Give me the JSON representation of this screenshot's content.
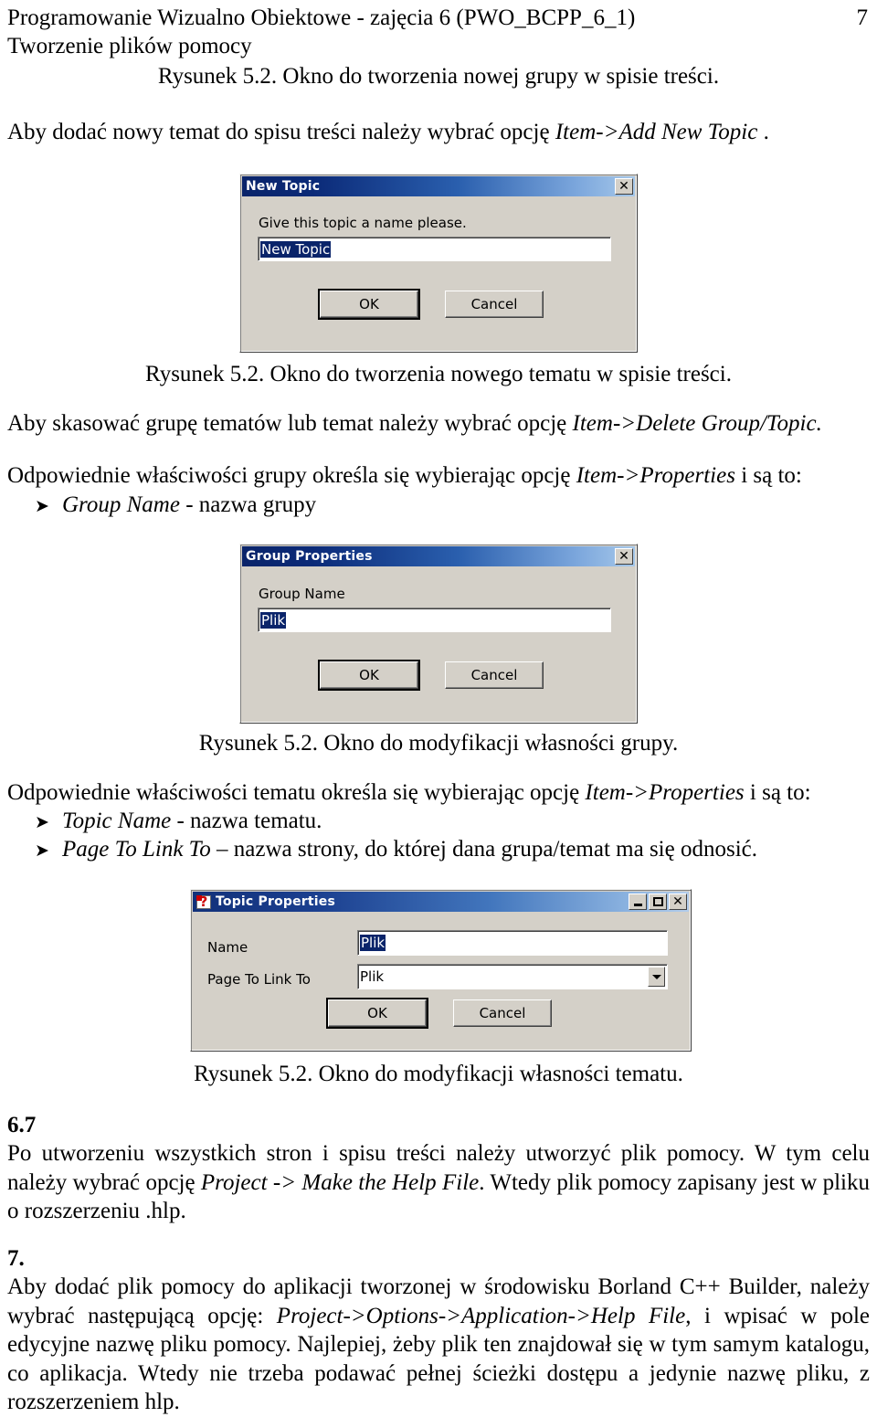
{
  "header": {
    "line1": "Programowanie Wizualno Obiektowe - zajęcia 6 (PWO_BCPP_6_1)",
    "line2": "Tworzenie plików pomocy",
    "page_number": "7"
  },
  "captions": {
    "fig1": "Rysunek 5.2. Okno do tworzenia nowej grupy w spisie treści.",
    "fig2": "Rysunek 5.2. Okno do tworzenia nowego tematu w spisie treści.",
    "fig3": "Rysunek 5.2. Okno do modyfikacji własności grupy.",
    "fig4": "Rysunek 5.2. Okno do modyfikacji własności tematu."
  },
  "body": {
    "para_add_topic_pre": "Aby dodać nowy temat do spisu treści należy wybrać opcję ",
    "para_add_topic_em": "Item->Add New Topic",
    "para_add_topic_post": " .",
    "para_delete_pre": "Aby skasować grupę tematów lub temat należy wybrać opcję ",
    "para_delete_em": "Item->Delete Group/Topic.",
    "para_group_props_pre": "Odpowiednie właściwości grupy określa się wybierając opcję ",
    "para_group_props_em": "Item->Properties",
    "para_group_props_post": " i są to:",
    "bullet_group_name_em": "Group Name",
    "bullet_group_name_rest": " - nazwa grupy",
    "para_topic_props_pre": "Odpowiednie właściwości tematu określa się wybierając opcję ",
    "para_topic_props_em": "Item->Properties",
    "para_topic_props_post": " i są to:",
    "bullet_topic_name_em": "Topic Name",
    "bullet_topic_name_rest": "   - nazwa tematu.",
    "bullet_page_link_em": "Page To Link To",
    "bullet_page_link_rest": " – nazwa strony, do której dana grupa/temat ma się odnosić.",
    "sec67_number": "6.7",
    "sec67_t1": "Po utworzeniu wszystkich stron i spisu treści należy utworzyć plik pomocy. W tym celu należy wybrać opcję ",
    "sec67_em": "Project -> Make the Help File",
    "sec67_t2": ". Wtedy plik pomocy zapisany jest w pliku o rozszerzeniu .hlp.",
    "sec7_number": "7.",
    "sec7_t1": "Aby dodać plik pomocy do aplikacji tworzonej w środowisku Borland C++ Builder, należy wybrać następującą opcję: ",
    "sec7_em": "Project->Options->Application->Help File",
    "sec7_t2": ", i wpisać w pole edycyjne nazwę pliku pomocy. Najlepiej, żeby plik ten znajdował się w tym samym katalogu, co aplikacja. Wtedy nie trzeba podawać pełnej ścieżki dostępu a jedynie nazwę pliku, z rozszerzeniem hlp."
  },
  "dialog_new_topic": {
    "title": "New Topic",
    "prompt": "Give this topic a name please.",
    "input_value": "New Topic",
    "ok_label": "OK",
    "cancel_label": "Cancel",
    "close_glyph": "✕"
  },
  "dialog_group_properties": {
    "title": "Group Properties",
    "label_group_name": "Group Name",
    "input_value": "Plik",
    "ok_label": "OK",
    "cancel_label": "Cancel",
    "close_glyph": "✕"
  },
  "dialog_topic_properties": {
    "title": "Topic Properties",
    "label_name": "Name",
    "label_page_to_link_to": "Page To Link To",
    "name_value": "Plik",
    "page_link_value": "Plik",
    "ok_label": "OK",
    "cancel_label": "Cancel",
    "minimize_glyph": "_",
    "maximize_glyph": "□",
    "close_glyph": "✕"
  },
  "colors": {
    "title_gradient_start": "#0a246a",
    "title_gradient_end": "#a6c8ea",
    "dialog_face": "#d4d0c8",
    "selection_blue": "#0a246a",
    "help_icon_red": "#cc0000"
  }
}
